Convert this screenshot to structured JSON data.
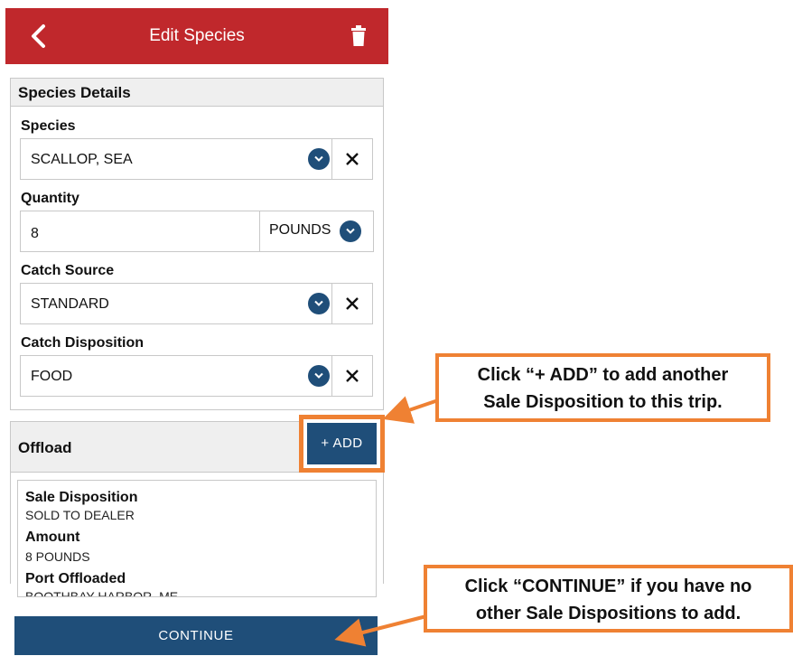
{
  "header": {
    "title": "Edit Species"
  },
  "species_details": {
    "heading": "Species Details",
    "fields": [
      {
        "label": "Species",
        "value": "SCALLOP, SEA"
      },
      {
        "label": "Quantity",
        "value": "8",
        "unit": "POUNDS"
      },
      {
        "label": "Catch Source",
        "value": "STANDARD"
      },
      {
        "label": "Catch Disposition",
        "value": "FOOD"
      }
    ]
  },
  "offload": {
    "heading": "Offload",
    "add_label": "+ ADD",
    "card": {
      "sale_disposition_label": "Sale Disposition",
      "sale_disposition_value": "SOLD TO DEALER",
      "amount_label": "Amount",
      "amount_value": "8 POUNDS",
      "port_label": "Port Offloaded",
      "port_value": "BOOTHBAY HARBOR, ME"
    }
  },
  "continue_label": "CONTINUE",
  "callouts": {
    "add_line1": "Click “+ ADD” to add another",
    "add_line2": "Sale Disposition to this trip.",
    "continue_line1": "Click “CONTINUE” if you have no",
    "continue_line2": "other Sale Dispositions to add."
  },
  "colors": {
    "header_red": "#c0282c",
    "button_blue": "#1f4e79",
    "callout_orange": "#ef8133"
  }
}
